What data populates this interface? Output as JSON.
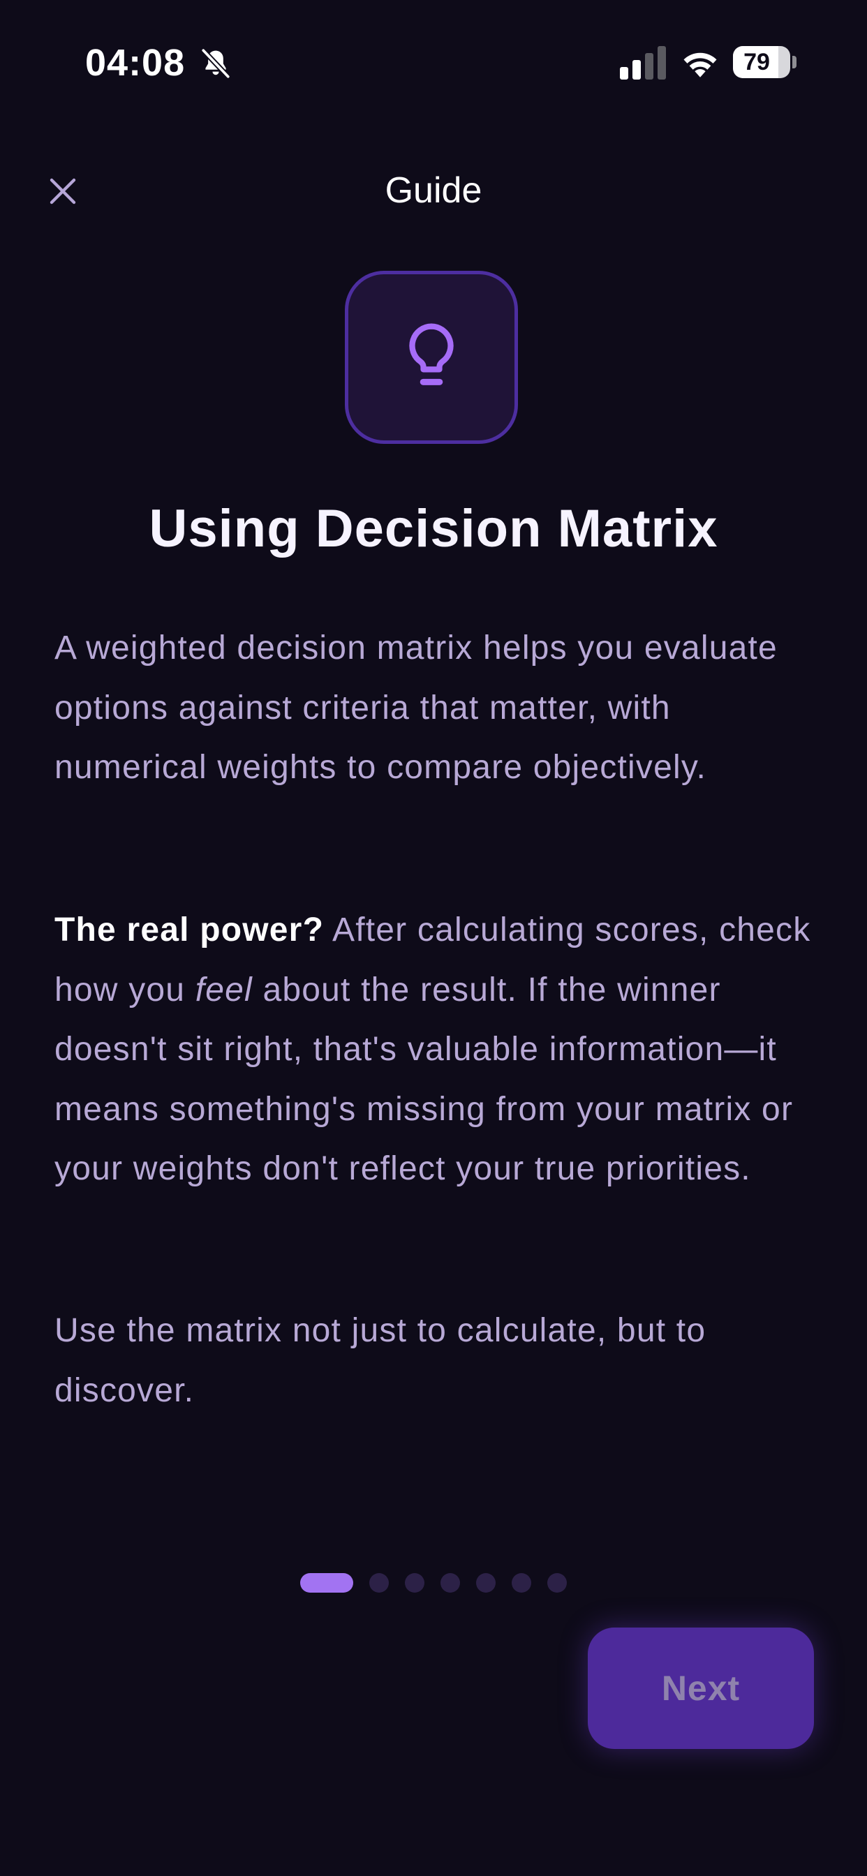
{
  "status_bar": {
    "time": "04:08",
    "battery_level": "79",
    "battery_fraction": 0.79,
    "icons": [
      "bell-slash-icon",
      "cellular-signal-icon",
      "wifi-icon",
      "battery-icon"
    ]
  },
  "header": {
    "title": "Guide",
    "close_icon": "close-icon"
  },
  "hero": {
    "icon": "lightbulb-icon",
    "accent_color": "#a66cf7"
  },
  "page": {
    "title": "Using Decision Matrix",
    "paragraph1": "A weighted decision matrix helps you evaluate options against criteria that matter, with numerical weights to compare objectively.",
    "paragraph2": {
      "lead": "The real power?",
      "part1": " After calculating scores, check how you ",
      "emphasis": "feel",
      "part2": " about the result. If the winner doesn't sit right, that's valuable information—it means something's missing from your matrix or your weights don't reflect your true priorities."
    },
    "paragraph3": "Use the matrix not just to calculate, but to discover."
  },
  "pagination": {
    "total": 7,
    "current": 1
  },
  "footer": {
    "next_label": "Next"
  },
  "colors": {
    "background": "#0e0b19",
    "body_text": "#b8a9d6",
    "active_dot": "#a273f2",
    "inactive_dot": "#2c2147",
    "button_bg": "#4d2a9b"
  }
}
